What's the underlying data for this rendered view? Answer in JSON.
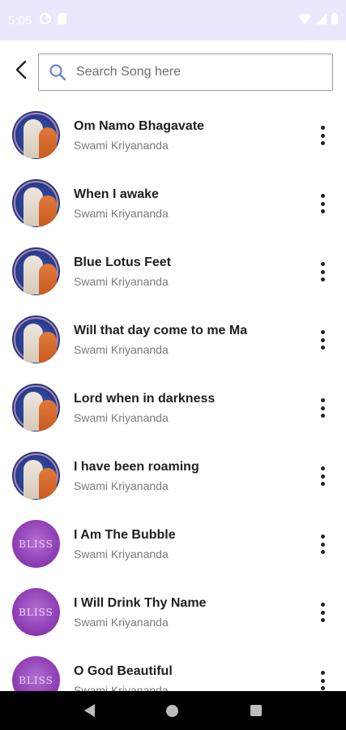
{
  "status_bar": {
    "time": "5:05",
    "icons": [
      "data-saver-icon",
      "sim-card-icon",
      "wifi-icon",
      "signal-icon",
      "battery-icon"
    ]
  },
  "search": {
    "placeholder": "Search Song here",
    "value": ""
  },
  "songs": [
    {
      "title": "Om Namo Bhagavate",
      "artist": "Swami Kriyananda",
      "thumb": "photo"
    },
    {
      "title": "When I awake",
      "artist": "Swami Kriyananda",
      "thumb": "photo"
    },
    {
      "title": "Blue Lotus Feet",
      "artist": "Swami Kriyananda",
      "thumb": "photo"
    },
    {
      "title": "Will that day come to me Ma",
      "artist": "Swami Kriyananda",
      "thumb": "photo"
    },
    {
      "title": "Lord when in darkness",
      "artist": "Swami Kriyananda",
      "thumb": "photo"
    },
    {
      "title": "I have been roaming",
      "artist": "Swami Kriyananda",
      "thumb": "photo"
    },
    {
      "title": "I Am The Bubble",
      "artist": "Swami Kriyananda",
      "thumb": "bliss",
      "thumb_text": "BLISS"
    },
    {
      "title": "I Will Drink Thy Name",
      "artist": "Swami Kriyananda",
      "thumb": "bliss",
      "thumb_text": "BLISS"
    },
    {
      "title": "O God Beautiful",
      "artist": "Swami Kriyananda",
      "thumb": "bliss",
      "thumb_text": "BLISS"
    }
  ],
  "colors": {
    "status_bar": "#ebe6fb",
    "search_icon": "#6a86c6",
    "title_text": "#1f1f1f",
    "artist_text": "#7a7a7a",
    "nav_bar": "#000000"
  }
}
